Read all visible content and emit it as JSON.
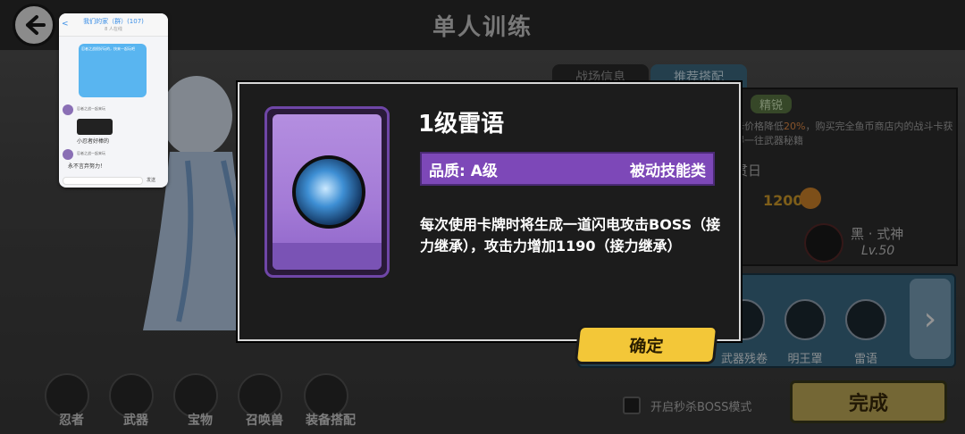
{
  "header": {
    "title": "单人训练"
  },
  "tabs": [
    {
      "label": "战场信息"
    },
    {
      "label": "推荐搭配"
    }
  ],
  "right_panel": {
    "badge": "精锐",
    "note_pre": "卡价格降低",
    "note_percent": "20%",
    "note_post": "，购买完全鱼币商店内的战斗卡获得一往武器秘籍",
    "day_label": "贯日",
    "coin_value": "1200",
    "shishen_name": "黑 · 式神",
    "shishen_level": "Lv.50"
  },
  "skill_slots": [
    {
      "label": "武器残卷"
    },
    {
      "label": "明王罩"
    },
    {
      "label": "雷语"
    }
  ],
  "bottom_nav": [
    {
      "label": "忍者"
    },
    {
      "label": "武器"
    },
    {
      "label": "宝物"
    },
    {
      "label": "召唤兽"
    },
    {
      "label": "装备搭配"
    }
  ],
  "instakill": {
    "label": "开启秒杀BOSS模式"
  },
  "done_button": "完成",
  "modal": {
    "skill_name": "1级雷语",
    "quality": "品质: A级",
    "category": "被动技能类",
    "description": "每次使用卡牌时将生成一道闪电攻击BOSS（接力继承），攻击力增加1190（接力继承）",
    "confirm_button": "确定"
  },
  "chat": {
    "back": "<",
    "title": "我们的家（群）(107)",
    "subtitle": "8 人在线",
    "bubble": "忍者之战很好玩的，快来一起玩吧",
    "msg_1": "忍者之战一起来玩",
    "msg_2": "忍者之战一起来玩",
    "caption": "小忍者好棒的",
    "reply": "永不言弃努力！",
    "send": "发送"
  },
  "colors": {
    "accent_purple": "#7d48b8",
    "confirm_yellow": "#f3c738",
    "skill_bar_blue": "#3d6e8a"
  }
}
